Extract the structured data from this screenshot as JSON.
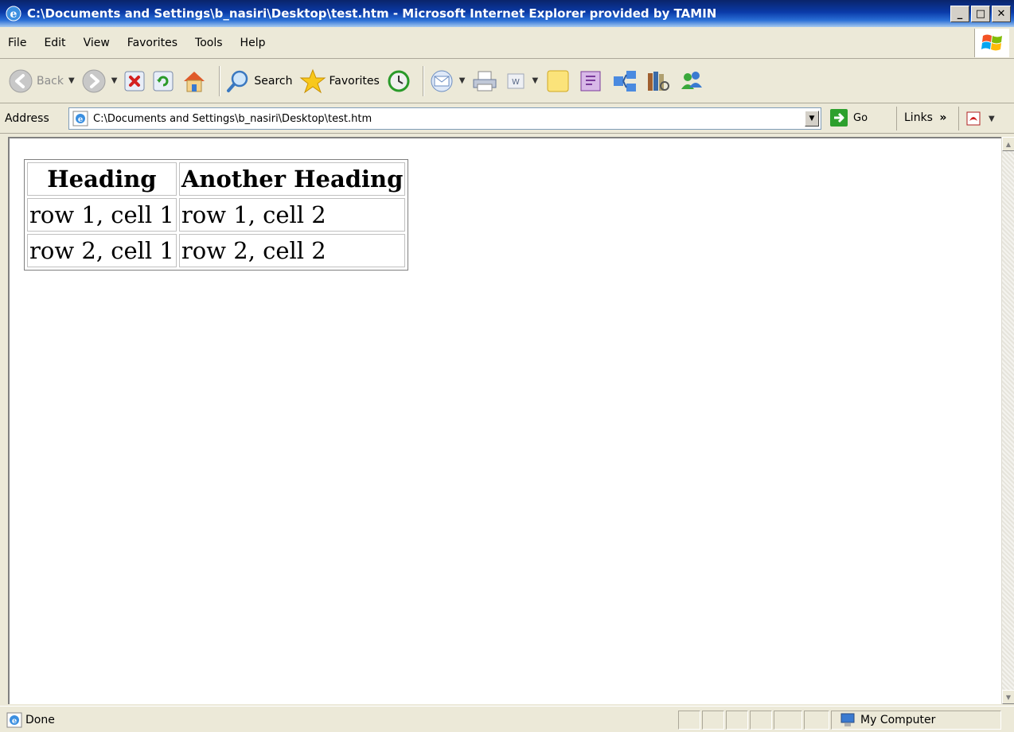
{
  "window": {
    "title": "C:\\Documents and Settings\\b_nasiri\\Desktop\\test.htm - Microsoft Internet Explorer provided by TAMIN",
    "controls": {
      "minimize": "_",
      "maximize": "□",
      "close": "✕"
    }
  },
  "menu": {
    "items": [
      "File",
      "Edit",
      "View",
      "Favorites",
      "Tools",
      "Help"
    ]
  },
  "toolbar": {
    "back_label": "Back",
    "search_label": "Search",
    "favorites_label": "Favorites"
  },
  "address": {
    "label": "Address",
    "value": "C:\\Documents and Settings\\b_nasiri\\Desktop\\test.htm",
    "go_label": "Go",
    "links_label": "Links",
    "links_chevron": "»"
  },
  "page_table": {
    "headers": [
      "Heading",
      "Another Heading"
    ],
    "rows": [
      [
        "row 1, cell 1",
        "row 1, cell 2"
      ],
      [
        "row 2, cell 1",
        "row 2, cell 2"
      ]
    ]
  },
  "status": {
    "text": "Done",
    "zone": "My Computer"
  },
  "colors": {
    "titlebar": "#0a3aa8",
    "chrome": "#ece9d8",
    "go_green": "#2da02d"
  }
}
